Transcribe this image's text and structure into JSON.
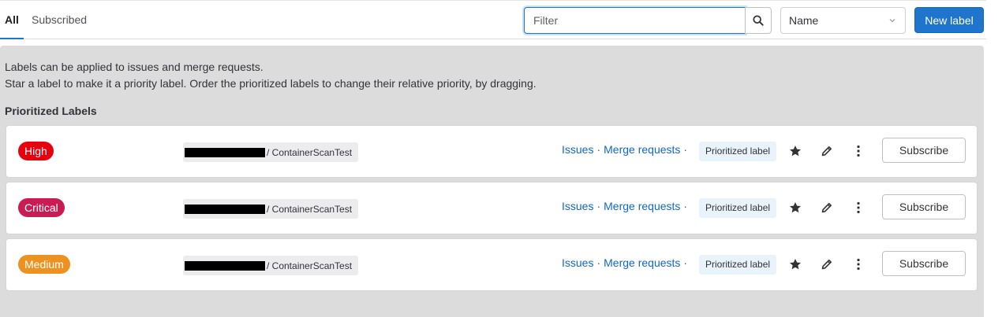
{
  "tabs": [
    {
      "label": "All",
      "active": true
    },
    {
      "label": "Subscribed",
      "active": false
    }
  ],
  "filter": {
    "placeholder": "Filter",
    "value": ""
  },
  "sort": {
    "selected": "Name"
  },
  "new_label_button": "New label",
  "help_text": {
    "line1": "Labels can be applied to issues and merge requests.",
    "line2": "Star a label to make it a priority label. Order the prioritized labels to change their relative priority, by dragging."
  },
  "section_title": "Prioritized Labels",
  "labels": [
    {
      "name": "High",
      "color": "#e8000c",
      "project": "/ ContainerScanTest",
      "issues_link": "Issues",
      "mr_link": "Merge requests",
      "badge": "Prioritized label",
      "subscribe": "Subscribe"
    },
    {
      "name": "Critical",
      "color": "#c91c55",
      "project": "/ ContainerScanTest",
      "issues_link": "Issues",
      "mr_link": "Merge requests",
      "badge": "Prioritized label",
      "subscribe": "Subscribe"
    },
    {
      "name": "Medium",
      "color": "#ed9121",
      "project": "/ ContainerScanTest",
      "issues_link": "Issues",
      "mr_link": "Merge requests",
      "badge": "Prioritized label",
      "subscribe": "Subscribe"
    }
  ],
  "icons": {
    "search": "search-icon",
    "sort_chevron": "chevron-down-icon",
    "star": "star-icon",
    "pencil": "pencil-icon",
    "kebab": "more-vertical-icon"
  },
  "colors": {
    "accent": "#1f75cb",
    "link": "#1068bf",
    "panel": "#dcdcdc"
  }
}
